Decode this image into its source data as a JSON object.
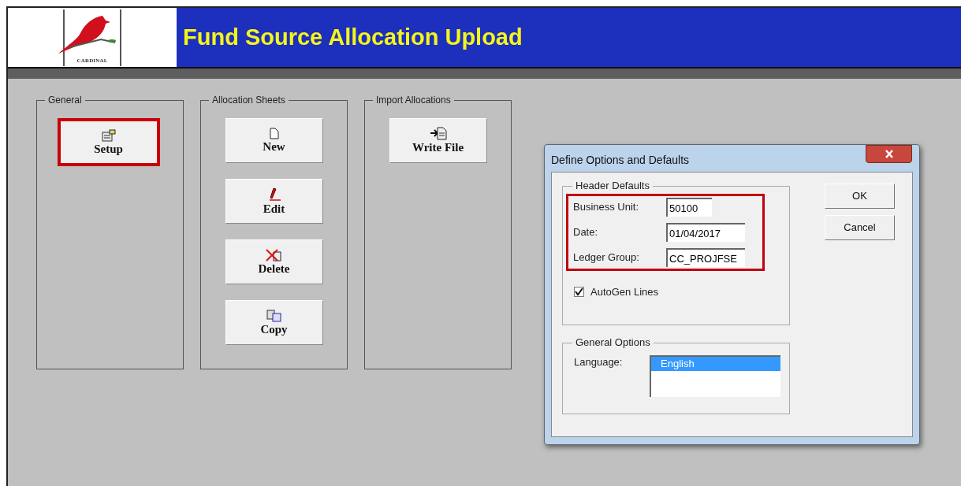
{
  "logo": {
    "text": "CARDINAL"
  },
  "header": {
    "title": "Fund Source Allocation Upload"
  },
  "groups": [
    {
      "title": "General",
      "buttons": [
        {
          "label": "Setup",
          "kind": "setup",
          "highlighted": true
        }
      ]
    },
    {
      "title": "Allocation Sheets",
      "buttons": [
        {
          "label": "New",
          "kind": "new",
          "highlighted": false
        },
        {
          "label": "Edit",
          "kind": "edit",
          "highlighted": false
        },
        {
          "label": "Delete",
          "kind": "delete",
          "highlighted": false
        },
        {
          "label": "Copy",
          "kind": "copy",
          "highlighted": false
        }
      ]
    },
    {
      "title": "Import Allocations",
      "buttons": [
        {
          "label": "Write File",
          "kind": "write",
          "highlighted": false
        }
      ]
    }
  ],
  "dialog": {
    "title": "Define Options and Defaults",
    "header_defaults": {
      "title": "Header Defaults",
      "highlighted": true,
      "fields": [
        {
          "label": "Business Unit:",
          "value": "50100"
        },
        {
          "label": "Date:",
          "value": "01/04/2017"
        },
        {
          "label": "Ledger Group:",
          "value": "CC_PROJFSE"
        }
      ]
    },
    "autogen": {
      "label": "AutoGen Lines",
      "checked": true
    },
    "general_options": {
      "title": "General Options",
      "language_label": "Language:",
      "languages": [
        {
          "label": "English",
          "selected": true
        }
      ]
    },
    "buttons": [
      "OK",
      "Cancel"
    ]
  }
}
